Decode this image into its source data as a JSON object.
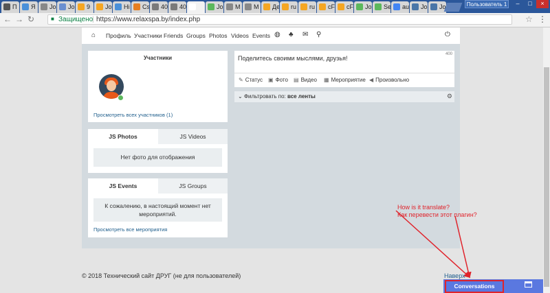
{
  "browser": {
    "tabs": [
      {
        "label": "П",
        "color": "#555555"
      },
      {
        "label": "Я",
        "color": "#4a90d9"
      },
      {
        "label": "Jo",
        "color": "#888888"
      },
      {
        "label": "Jo",
        "color": "#6a8fd0"
      },
      {
        "label": "9",
        "color": "#f5a623"
      },
      {
        "label": "Jo",
        "color": "#f5a623"
      },
      {
        "label": "Hi",
        "color": "#4a90d9"
      },
      {
        "label": "Cs",
        "color": "#e67e22"
      },
      {
        "label": "40",
        "color": "#7a7a7a"
      },
      {
        "label": "40",
        "color": "#7a7a7a"
      },
      {
        "label": "",
        "color": "#ffffff"
      },
      {
        "label": "Jo",
        "color": "#5cb85c"
      },
      {
        "label": "M",
        "color": "#888888"
      },
      {
        "label": "M",
        "color": "#888888"
      },
      {
        "label": "Де",
        "color": "#f5a623"
      },
      {
        "label": "ru",
        "color": "#f5a623"
      },
      {
        "label": "ru",
        "color": "#f5a623"
      },
      {
        "label": "cF",
        "color": "#f5a623"
      },
      {
        "label": "cF",
        "color": "#f5a623"
      },
      {
        "label": "Jo",
        "color": "#5cb85c"
      },
      {
        "label": "Se",
        "color": "#5cb85c"
      },
      {
        "label": "au",
        "color": "#4285f4"
      },
      {
        "label": "Jo",
        "color": "#4a76a8"
      },
      {
        "label": "Jo",
        "color": "#4a76a8"
      }
    ],
    "user_button": "Пользователь 1",
    "secure_label": "Защищено",
    "separator": "|",
    "url": "https://www.relaxspa.by/index.php"
  },
  "nav": {
    "items": [
      "Профиль",
      "Участники",
      "Friends",
      "Groups",
      "Photos",
      "Videos",
      "Events"
    ],
    "icons": [
      "home-icon",
      "globe-icon",
      "friend-request-icon",
      "mail-icon",
      "search-icon",
      "power-icon"
    ]
  },
  "members": {
    "title": "Участники",
    "view_all": "Просмотреть всех участников (1)"
  },
  "media": {
    "tab_photos": "JS Photos",
    "tab_videos": "JS Videos",
    "empty": "Нет фото для отображения"
  },
  "events": {
    "tab_events": "JS Events",
    "tab_groups": "JS Groups",
    "empty_line1": "К сожалению, в настоящий момент нет",
    "empty_line2": "мероприятий.",
    "view_all": "Просмотреть все мероприятия"
  },
  "composer": {
    "placeholder": "Поделитесь своими мыслями, друзья!",
    "counter": "400",
    "actions": [
      "Статус",
      "Фото",
      "Видео",
      "Мероприятие",
      "Произвольно"
    ]
  },
  "filter": {
    "label": "Фильтровать по:",
    "value": "все ленты"
  },
  "footer": {
    "copyright": "© 2018 Технический сайт ДРУГ (не для пользователей)",
    "top_link": "Наверх"
  },
  "annotation": {
    "line1": "How is it translate?",
    "line2": "Как перевести этот плагин?"
  },
  "conversations": {
    "label": "Conversations"
  },
  "colors": {
    "accent": "#5a78e0",
    "annotation": "#e0232b",
    "link": "#1f5e8c"
  }
}
